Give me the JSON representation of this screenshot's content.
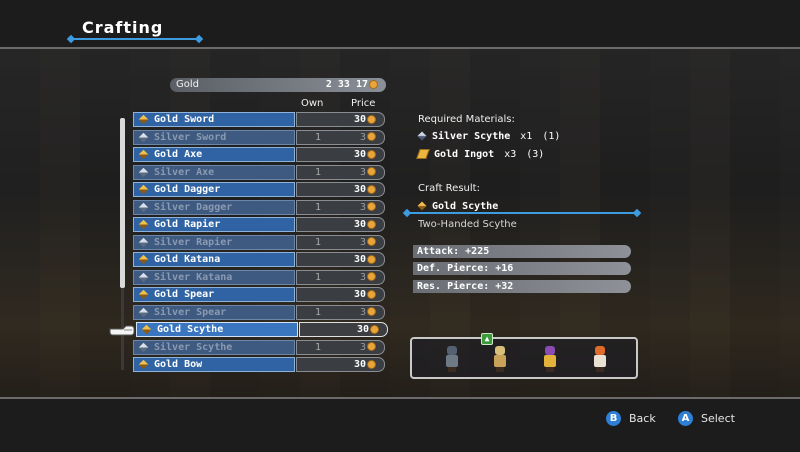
{
  "header": {
    "title": "Crafting"
  },
  "gold": {
    "label": "Gold",
    "amount": "2 33 17"
  },
  "columns": {
    "own": "Own",
    "price": "Price"
  },
  "items": [
    {
      "name": "Gold Sword",
      "own": "",
      "price": "30",
      "available": true,
      "material": "gold"
    },
    {
      "name": "Silver Sword",
      "own": "1",
      "price": "3",
      "available": false,
      "material": "silver"
    },
    {
      "name": "Gold Axe",
      "own": "",
      "price": "30",
      "available": true,
      "material": "gold"
    },
    {
      "name": "Silver Axe",
      "own": "1",
      "price": "3",
      "available": false,
      "material": "silver"
    },
    {
      "name": "Gold Dagger",
      "own": "",
      "price": "30",
      "available": true,
      "material": "gold"
    },
    {
      "name": "Silver Dagger",
      "own": "1",
      "price": "3",
      "available": false,
      "material": "silver"
    },
    {
      "name": "Gold Rapier",
      "own": "",
      "price": "30",
      "available": true,
      "material": "gold"
    },
    {
      "name": "Silver Rapier",
      "own": "1",
      "price": "3",
      "available": false,
      "material": "silver"
    },
    {
      "name": "Gold Katana",
      "own": "",
      "price": "30",
      "available": true,
      "material": "gold"
    },
    {
      "name": "Silver Katana",
      "own": "1",
      "price": "3",
      "available": false,
      "material": "silver"
    },
    {
      "name": "Gold Spear",
      "own": "",
      "price": "30",
      "available": true,
      "material": "gold"
    },
    {
      "name": "Silver Spear",
      "own": "1",
      "price": "3",
      "available": false,
      "material": "silver"
    },
    {
      "name": "Gold Scythe",
      "own": "",
      "price": "30",
      "available": true,
      "material": "gold",
      "selected": true
    },
    {
      "name": "Silver Scythe",
      "own": "1",
      "price": "3",
      "available": false,
      "material": "silver"
    },
    {
      "name": "Gold Bow",
      "own": "",
      "price": "30",
      "available": true,
      "material": "gold"
    }
  ],
  "materials": {
    "label": "Required Materials:",
    "list": [
      {
        "name": "Silver Scythe",
        "qty": "x1",
        "have": "(1)",
        "icon": "scythe-icon"
      },
      {
        "name": "Gold Ingot",
        "qty": "x3",
        "have": "(3)",
        "icon": "ingot-icon"
      }
    ]
  },
  "result": {
    "label": "Craft Result:",
    "name": "Gold Scythe",
    "type": "Two-Handed Scythe"
  },
  "stats": [
    {
      "text": "Attack:  +225"
    },
    {
      "text": "Def. Pierce:  +16"
    },
    {
      "text": "Res. Pierce:  +32"
    }
  ],
  "footer": {
    "back": "Back",
    "select": "Select",
    "back_key": "B",
    "select_key": "A"
  },
  "colors": {
    "accent": "#3d9be0",
    "row_blue": "#2f63a3",
    "gold_coin": "#e8a53a"
  }
}
